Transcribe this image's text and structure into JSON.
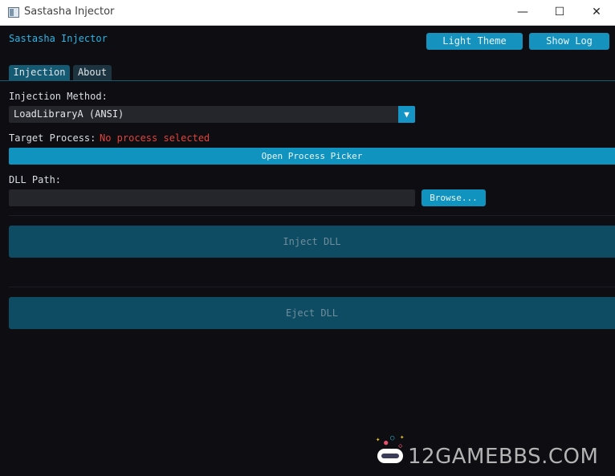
{
  "window": {
    "title": "Sastasha Injector",
    "minimize_glyph": "—",
    "maximize_glyph": "☐",
    "close_glyph": "✕"
  },
  "header": {
    "brand": "Sastasha Injector",
    "light_theme_label": "Light Theme",
    "show_log_label": "Show Log"
  },
  "tabs": [
    {
      "label": "Injection",
      "active": true
    },
    {
      "label": "About",
      "active": false
    }
  ],
  "injection": {
    "method_label": "Injection Method:",
    "method_value": "LoadLibraryA (ANSI)",
    "dropdown_arrow": "▼",
    "target_label": "Target Process:",
    "target_status": "No process selected",
    "open_picker_label": "Open Process Picker",
    "dll_path_label": "DLL Path:",
    "dll_path_value": "",
    "dll_path_placeholder": "",
    "browse_label": "Browse...",
    "inject_label": "Inject DLL",
    "eject_label": "Eject DLL"
  },
  "watermark": {
    "text": "12GAMEBBS.COM"
  },
  "colors": {
    "accent": "#1193bf",
    "background": "#0d0d12",
    "error": "#e0443c",
    "disabled_button": "#0e4c63"
  },
  "icons": [
    "app-window-icon",
    "minimize-icon",
    "maximize-icon",
    "close-icon",
    "chevron-down-icon",
    "gamepad-icon"
  ]
}
